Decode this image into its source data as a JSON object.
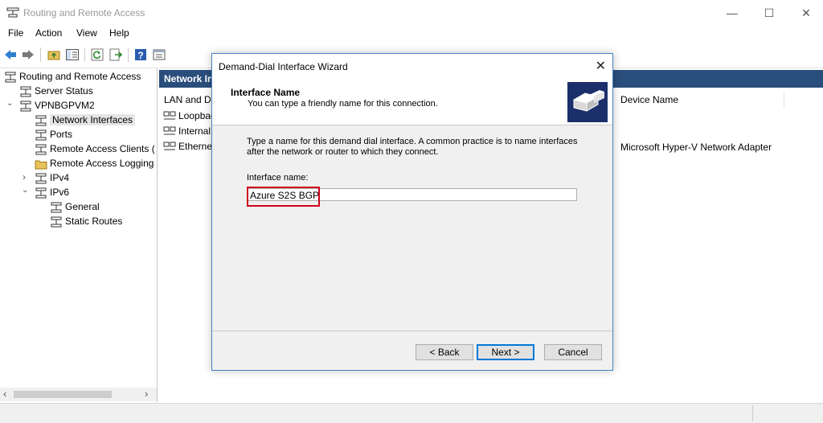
{
  "window": {
    "title": "Routing and Remote Access",
    "minimize_glyph": "—",
    "maximize_glyph": "☐",
    "close_glyph": "✕"
  },
  "menu": [
    "File",
    "Action",
    "View",
    "Help"
  ],
  "toolbar": {
    "icons": [
      "back-arrow-icon",
      "forward-arrow-icon",
      "up-folder-icon",
      "show-hide-tree-icon",
      "refresh-icon",
      "export-list-icon",
      "help-icon",
      "properties-icon"
    ]
  },
  "tree": [
    {
      "label": "Routing and Remote Access",
      "level": 0,
      "expander": ""
    },
    {
      "label": "Server Status",
      "level": 1,
      "expander": ""
    },
    {
      "label": "VPNBGPVM2",
      "level": 1,
      "expander": "⌄"
    },
    {
      "label": "Network Interfaces",
      "level": 2,
      "expander": "",
      "selected": true
    },
    {
      "label": "Ports",
      "level": 2,
      "expander": ""
    },
    {
      "label": "Remote Access Clients (",
      "level": 2,
      "expander": ""
    },
    {
      "label": "Remote Access Logging",
      "level": 2,
      "expander": ""
    },
    {
      "label": "IPv4",
      "level": 2,
      "expander": "›"
    },
    {
      "label": "IPv6",
      "level": 2,
      "expander": "⌄"
    },
    {
      "label": "General",
      "level": 3,
      "expander": ""
    },
    {
      "label": "Static Routes",
      "level": 3,
      "expander": ""
    }
  ],
  "tree_scroll": {
    "left_arrow": "‹",
    "right_arrow": "›"
  },
  "right_pane": {
    "header": "Network Interfaces",
    "columns": [
      "LAN and D",
      "Device Name"
    ],
    "rows": [
      {
        "name": "Loopback",
        "device": ""
      },
      {
        "name": "Internal",
        "device": ""
      },
      {
        "name": "Ethernet",
        "device": "Microsoft Hyper-V Network Adapter"
      }
    ]
  },
  "dialog": {
    "title": "Demand-Dial Interface Wizard",
    "close_glyph": "✕",
    "heading": "Interface Name",
    "subheading": "You can type a friendly name for this connection.",
    "description": "Type a name for this demand dial interface.  A common practice is to name interfaces after the network or router to which they connect.",
    "field_label": "Interface name:",
    "field_value": "Azure S2S BGP",
    "buttons": {
      "back": "< Back",
      "next": "Next >",
      "cancel": "Cancel"
    }
  },
  "colors": {
    "accent": "#0078d7",
    "highlight": "#d0021b",
    "header_bg": "#2a4e7c"
  }
}
